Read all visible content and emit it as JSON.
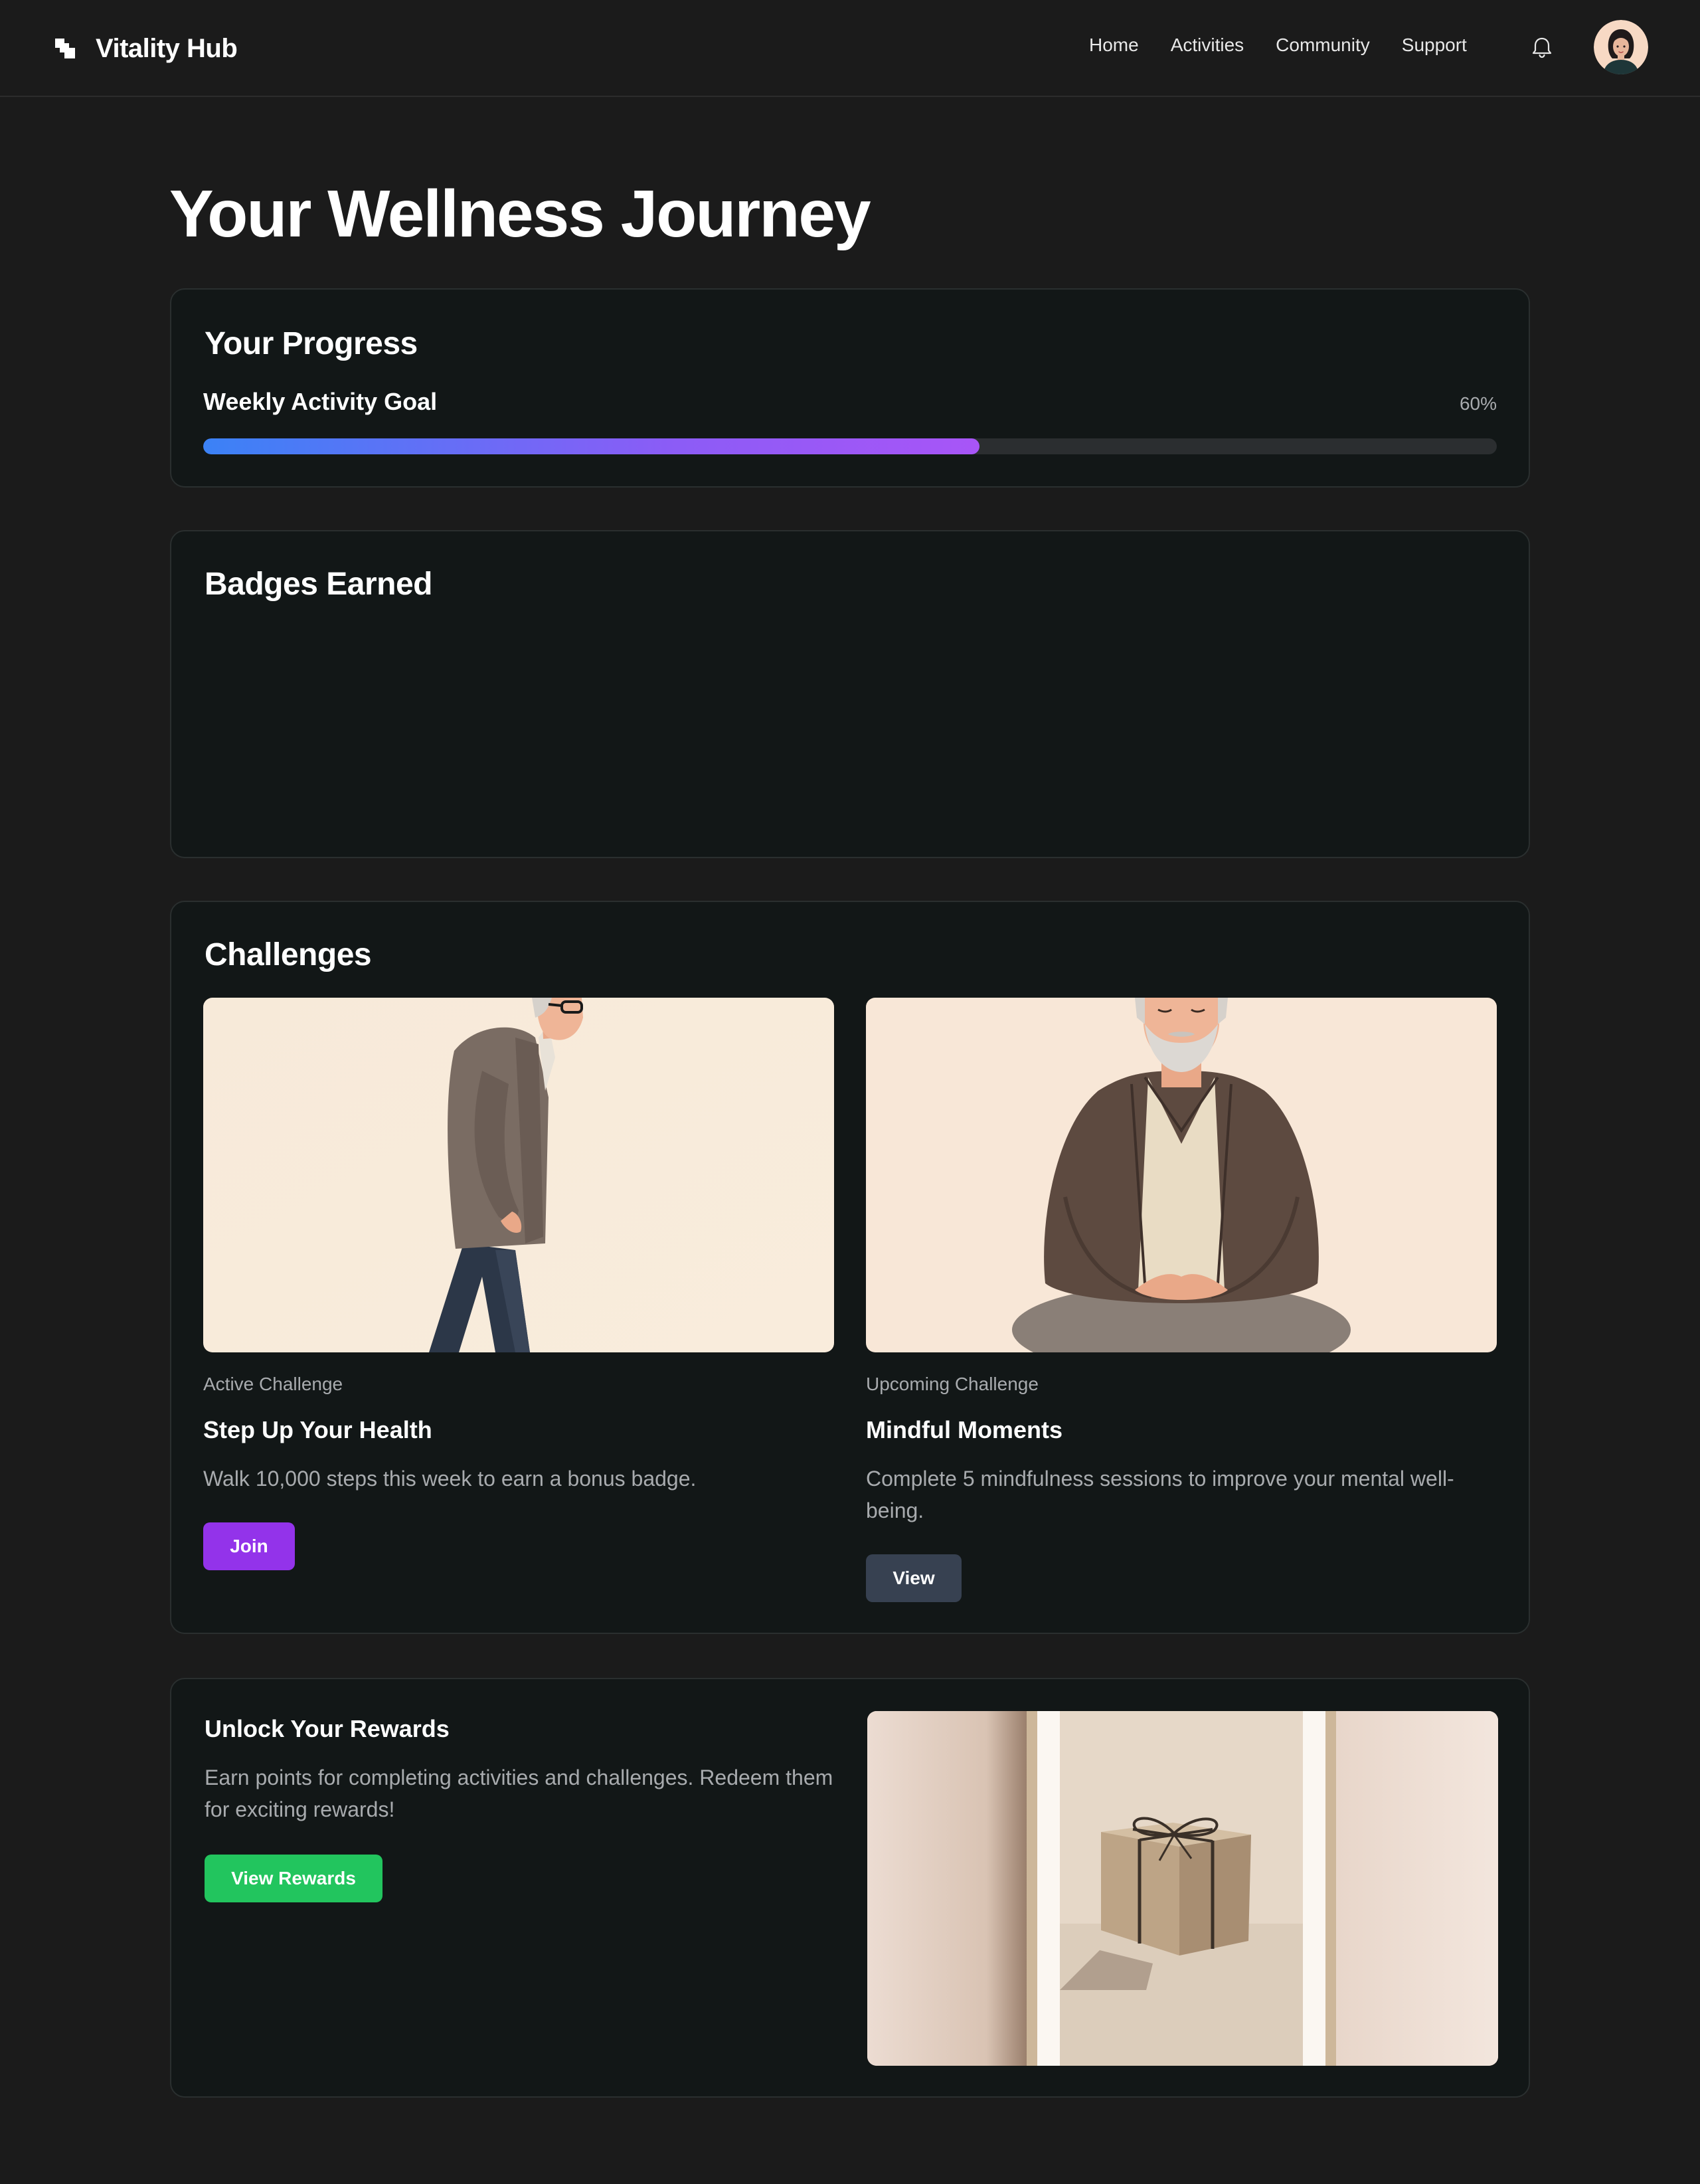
{
  "header": {
    "brand": "Vitality Hub",
    "nav": [
      "Home",
      "Activities",
      "Community",
      "Support"
    ]
  },
  "page": {
    "title": "Your Wellness Journey"
  },
  "progress": {
    "title": "Your Progress",
    "goal_label": "Weekly Activity Goal",
    "percent_label": "60%",
    "value": 0.6
  },
  "badges": {
    "title": "Badges Earned"
  },
  "challenges": {
    "title": "Challenges",
    "items": [
      {
        "status": "Active Challenge",
        "title": "Step Up Your Health",
        "description": "Walk 10,000 steps this week to earn a bonus badge.",
        "button": "Join"
      },
      {
        "status": "Upcoming Challenge",
        "title": "Mindful Moments",
        "description": "Complete 5 mindfulness sessions to improve your mental well-being.",
        "button": "View"
      }
    ]
  },
  "rewards": {
    "title": "Unlock Your Rewards",
    "description": "Earn points for completing activities and challenges. Redeem them for exciting rewards!",
    "button": "View Rewards"
  },
  "colors": {
    "background": "#1b1b1b",
    "card": "#121717",
    "accent_purple": "#9333ea",
    "accent_green": "#22c55e",
    "progress_start": "#3b82f6",
    "progress_end": "#a855f7",
    "muted_text": "#a8abae"
  },
  "icons": {
    "logo": "logo-icon",
    "notifications": "bell-icon",
    "avatar": "user-avatar"
  }
}
